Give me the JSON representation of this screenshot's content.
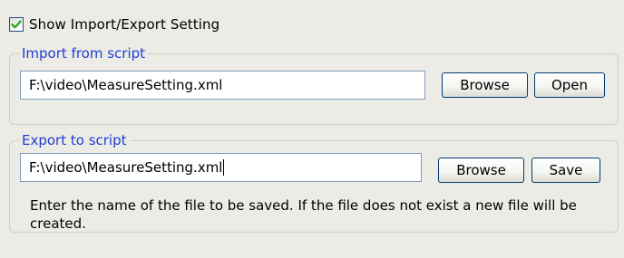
{
  "show_setting": {
    "checked": true,
    "label": "Show Import/Export Setting"
  },
  "import_group": {
    "legend": "Import from script",
    "path_value": "F:\\video\\MeasureSetting.xml",
    "browse_label": "Browse",
    "open_label": "Open"
  },
  "export_group": {
    "legend": "Export to script",
    "path_value": "F:\\video\\MeasureSetting.xml",
    "browse_label": "Browse",
    "save_label": "Save",
    "hint": "Enter the name of the file to be saved. If the file does not exist a new file will be created."
  },
  "colors": {
    "legend_text": "#1f3fd6",
    "background": "#ecebe6",
    "group_border": "#d0d0bf",
    "check_mark": "#21a121"
  }
}
